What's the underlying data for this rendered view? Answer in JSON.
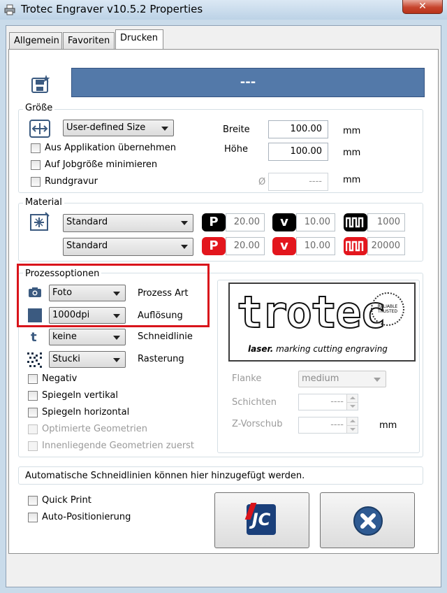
{
  "window": {
    "title": "Trotec Engraver v10.5.2 Properties",
    "close_label": "✕"
  },
  "tabs": [
    {
      "label": "Allgemein"
    },
    {
      "label": "Favoriten"
    },
    {
      "label": "Drucken"
    }
  ],
  "job_banner": {
    "text": "---"
  },
  "size": {
    "group_label": "Größe",
    "preset": "User-defined Size",
    "chk_app": "Aus Applikation übernehmen",
    "chk_min": "Auf Jobgröße minimieren",
    "chk_round": "Rundgravur",
    "width_label": "Breite",
    "width_value": "100.00",
    "width_unit": "mm",
    "height_label": "Höhe",
    "height_value": "100.00",
    "height_unit": "mm",
    "diameter_symbol": "Ø",
    "diameter_value": "----",
    "diameter_unit": "mm"
  },
  "material": {
    "group_label": "Material",
    "row1": {
      "name": "Standard",
      "p": "20.00",
      "v": "10.00",
      "hz": "1000"
    },
    "row2": {
      "name": "Standard",
      "p": "20.00",
      "v": "10.00",
      "hz": "20000"
    },
    "p_letter": "P",
    "v_letter": "v"
  },
  "process": {
    "group_label": "Prozessoptionen",
    "art_value": "Foto",
    "art_label": "Prozess Art",
    "res_value": "1000dpi",
    "res_label": "Auflösung",
    "cut_value": "keine",
    "cut_label": "Schneidlinie",
    "raster_value": "Stucki",
    "raster_label": "Rasterung",
    "cut_icon_glyph": "t",
    "chk_negativ": "Negativ",
    "chk_mirror_v": "Spiegeln vertikal",
    "chk_mirror_h": "Spiegeln horizontal",
    "chk_opt": "Optimierte Geometrien",
    "chk_inner": "Innenliegende Geometrien zuerst",
    "highlight_color": "#d9141b"
  },
  "logo": {
    "word": "trotec",
    "tagline_bold": "laser.",
    "tagline": " marking cutting engraving",
    "stamp": "RELIABLE TRUSTED"
  },
  "engrave": {
    "flanke_label": "Flanke",
    "flanke_value": "medium",
    "schichten_label": "Schichten",
    "schichten_value": "----",
    "zvorschub_label": "Z-Vorschub",
    "zvorschub_value": "----",
    "zvorschub_unit": "mm"
  },
  "info": {
    "text": "Automatische Schneidlinien können hier hinzugefügt werden."
  },
  "bottom": {
    "chk_quick": "Quick Print",
    "chk_autopos": "Auto-Positionierung",
    "jc_logo": "JC"
  }
}
